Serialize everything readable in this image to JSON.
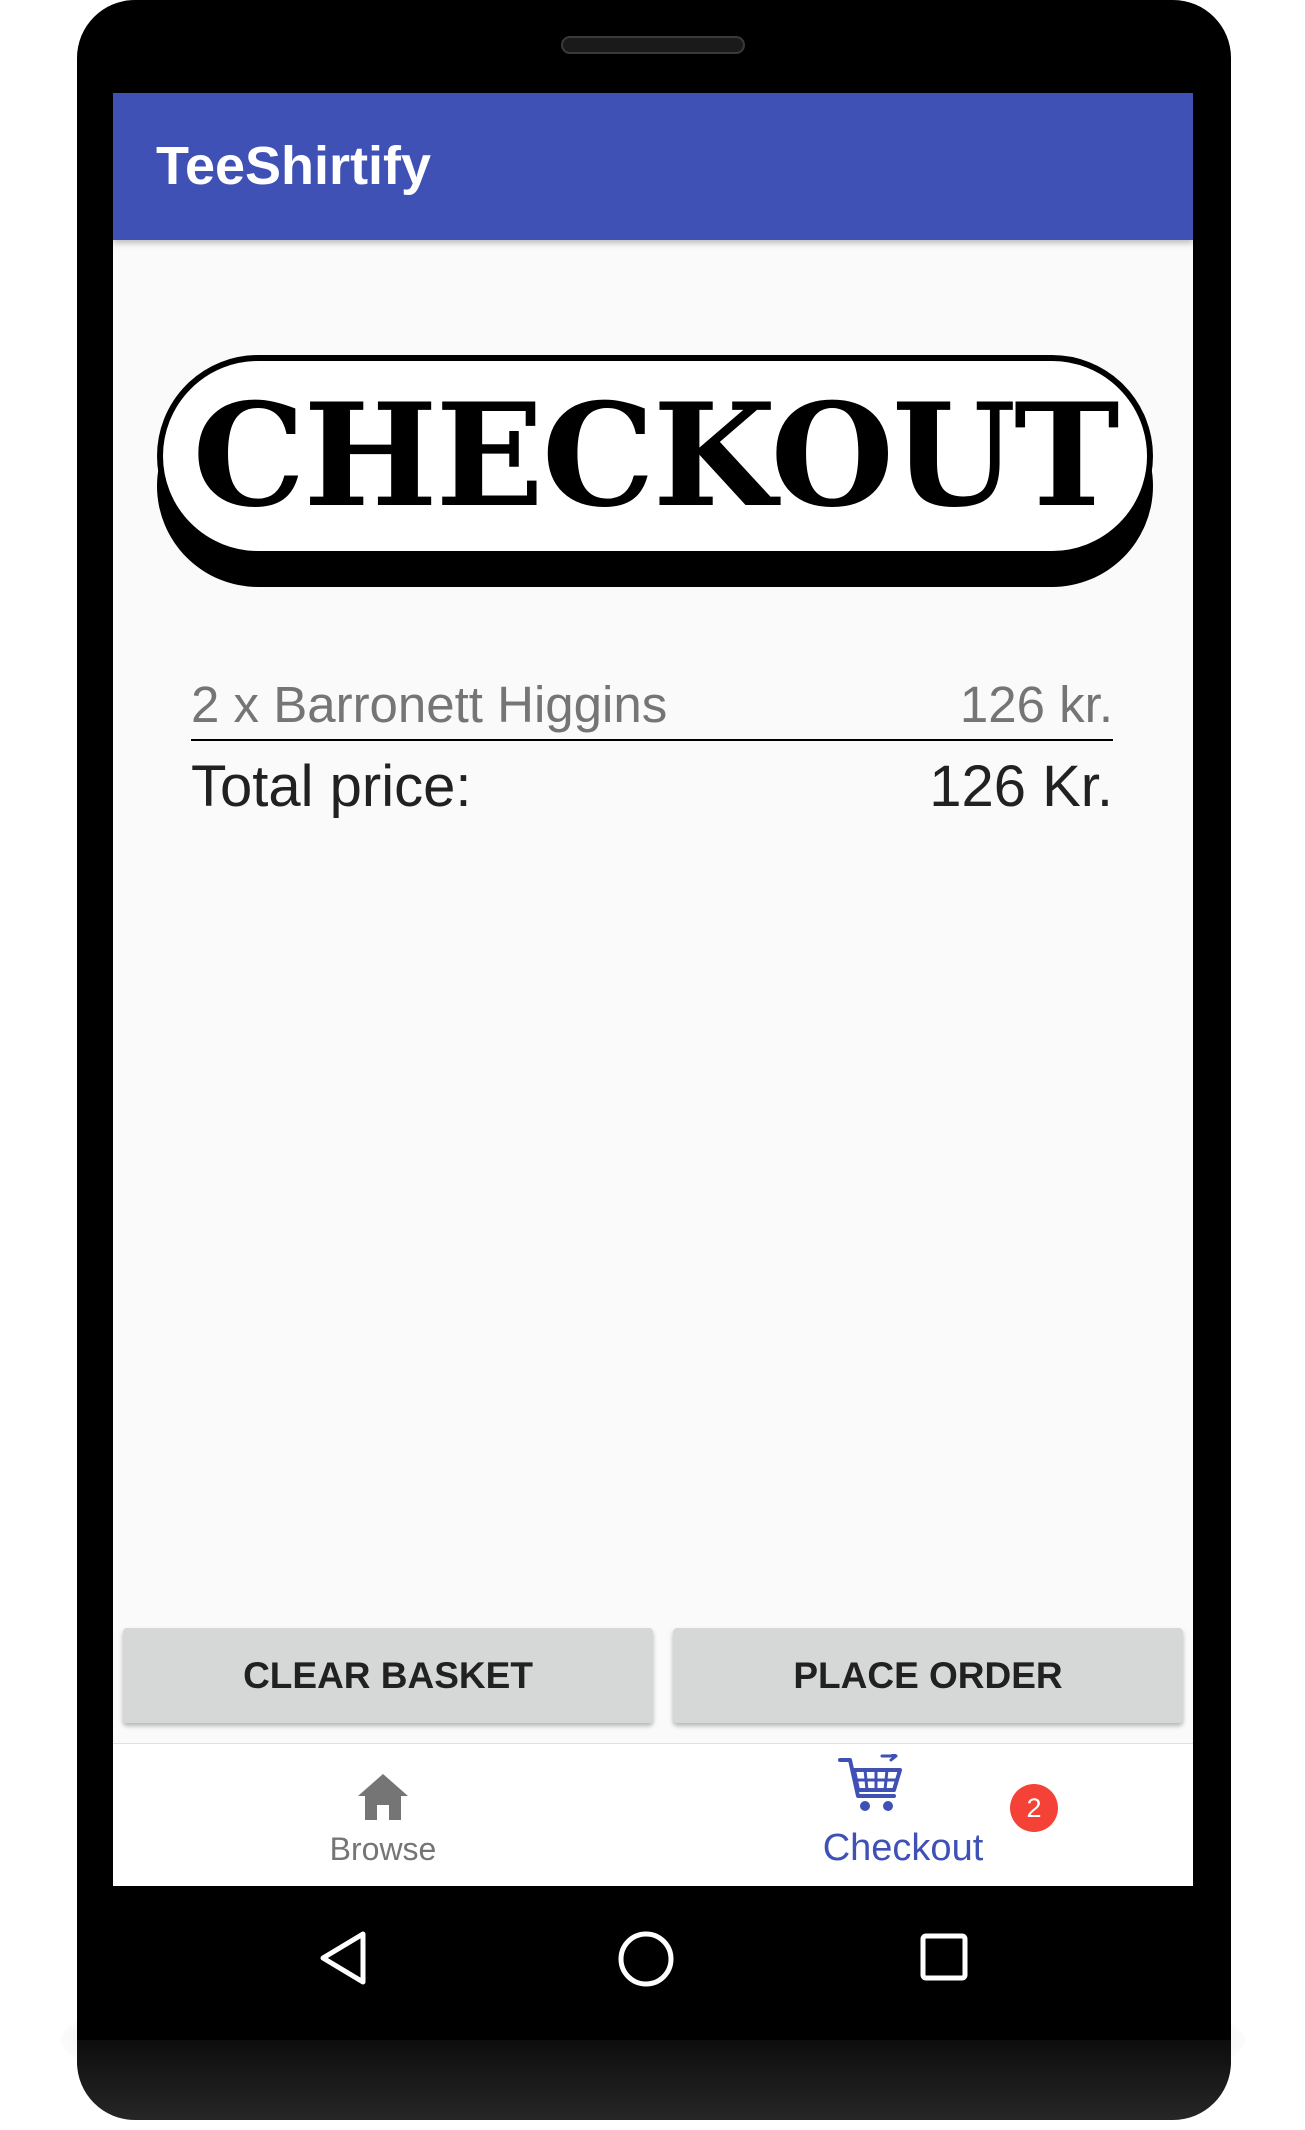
{
  "app_bar": {
    "title": "TeeShirtify"
  },
  "banner": {
    "text": "CHECKOUT"
  },
  "basket": {
    "items": [
      {
        "label": "2 x Barronett Higgins",
        "price": "126 kr."
      }
    ],
    "total_label": "Total price:",
    "total_value": "126 Kr."
  },
  "actions": {
    "clear_label": "CLEAR BASKET",
    "place_label": "PLACE ORDER"
  },
  "bottom_nav": {
    "items": [
      {
        "label": "Browse",
        "icon": "home-icon",
        "active": false
      },
      {
        "label": "Checkout",
        "icon": "cart-icon",
        "active": true,
        "badge": "2"
      }
    ]
  },
  "system_nav": {
    "icons": [
      "back-icon",
      "home-circle-icon",
      "recents-icon"
    ]
  },
  "colors": {
    "primary": "#3f51b5",
    "badge": "#f44336",
    "button": "#d6d7d7",
    "inactive": "#757575"
  }
}
